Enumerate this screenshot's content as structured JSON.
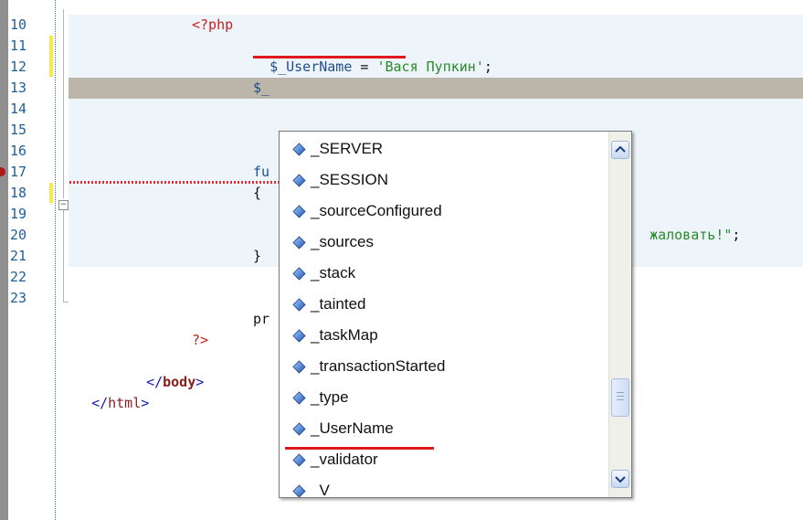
{
  "editor": {
    "lines": [
      {
        "num": "10"
      },
      {
        "num": "11"
      },
      {
        "num": "12"
      },
      {
        "num": "13"
      },
      {
        "num": "14"
      },
      {
        "num": "15"
      },
      {
        "num": "16"
      },
      {
        "num": "17"
      },
      {
        "num": "18"
      },
      {
        "num": "19"
      },
      {
        "num": "20"
      },
      {
        "num": "21"
      },
      {
        "num": "22"
      },
      {
        "num": "23"
      }
    ],
    "code": {
      "l10_open": "<?php",
      "l11_var": "$_UserName",
      "l11_eq": " = ",
      "l11_str": "'Вася Пупкин'",
      "l11_semi": ";",
      "l13_var": "$_",
      "l15_fn": "fu",
      "l16_brace": "{",
      "l17_str": "жаловать!\"",
      "l17_semi": ";",
      "l18_brace": "}",
      "l20_pr": "pr",
      "l21_close": "?>",
      "l22_open": "</",
      "l22_name": "body",
      "l22_close": ">",
      "l23_open": "</",
      "l23_name": "html",
      "l23_close": ">"
    },
    "colors": {
      "current_line": "#bbb6a9",
      "php_block_bg": "#eef5fa",
      "underline": "#e0181e"
    }
  },
  "autocomplete": {
    "items": [
      {
        "label": "_SERVER"
      },
      {
        "label": "_SESSION"
      },
      {
        "label": "_sourceConfigured"
      },
      {
        "label": "_sources"
      },
      {
        "label": "_stack"
      },
      {
        "label": "_tainted"
      },
      {
        "label": "_taskMap"
      },
      {
        "label": "_transactionStarted"
      },
      {
        "label": "_type"
      },
      {
        "label": "_UserName"
      },
      {
        "label": "_validator"
      },
      {
        "label": "_V"
      }
    ],
    "icon": "variable-diamond-icon",
    "scroll_position": 0.68
  }
}
